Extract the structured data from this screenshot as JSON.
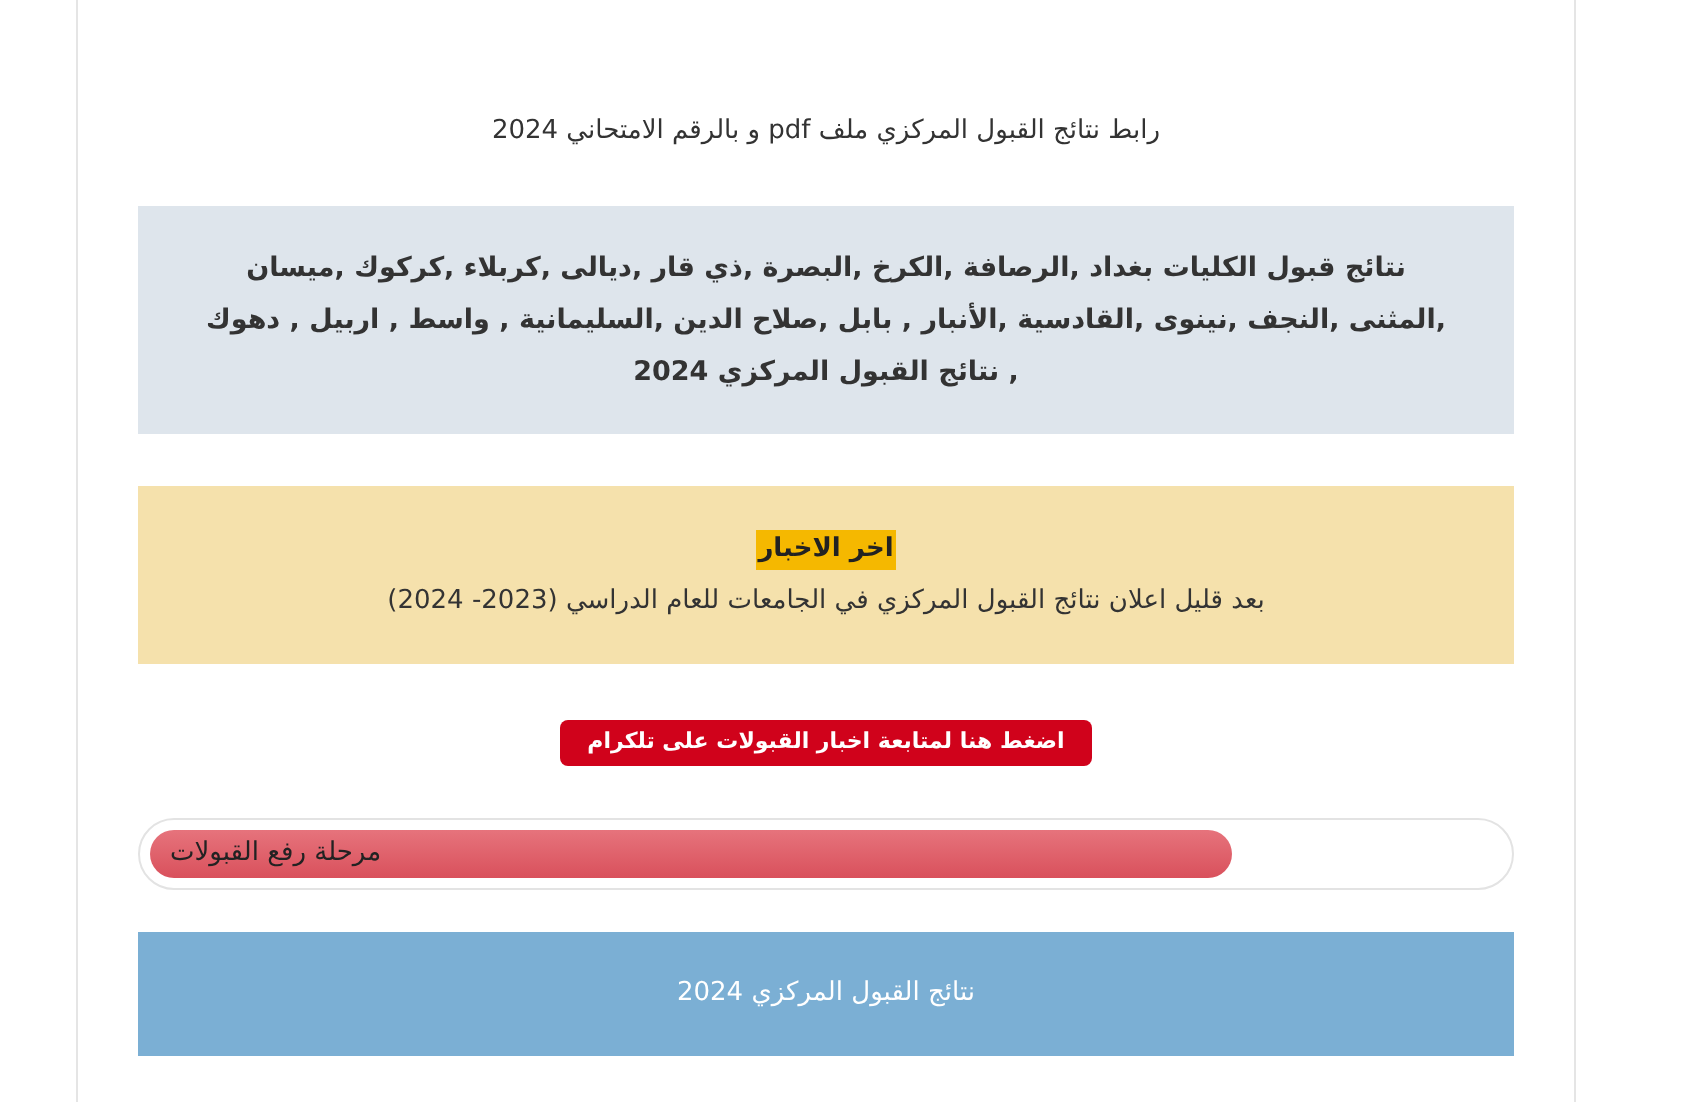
{
  "link_title": "رابط نتائج القبول المركزي ملف pdf و بالرقم الامتحاني 2024",
  "provinces_box": "نتائج قبول الكليات بغداد ,الرصافة ,الكرخ ,البصرة ,ذي قار ,ديالى ,كربلاء ,كركوك ,ميسان ,المثنى ,النجف ,نينوى ,القادسية ,الأنبار , بابل ,صلاح الدين ,السليمانية , واسط , اربيل , دهوك , نتائج القبول المركزي 2024",
  "news_box": {
    "heading": "اخر الاخبار",
    "text": "بعد قليل اعلان نتائج القبول المركزي في الجامعات للعام الدراسي (2023- 2024)"
  },
  "telegram_button": "اضغط هنا لمتابعة اخبار القبولات على تلكرام",
  "progress": {
    "label": "مرحلة رفع القبولات",
    "level": 0.8
  },
  "banner": "نتائج القبول المركزي 2024"
}
